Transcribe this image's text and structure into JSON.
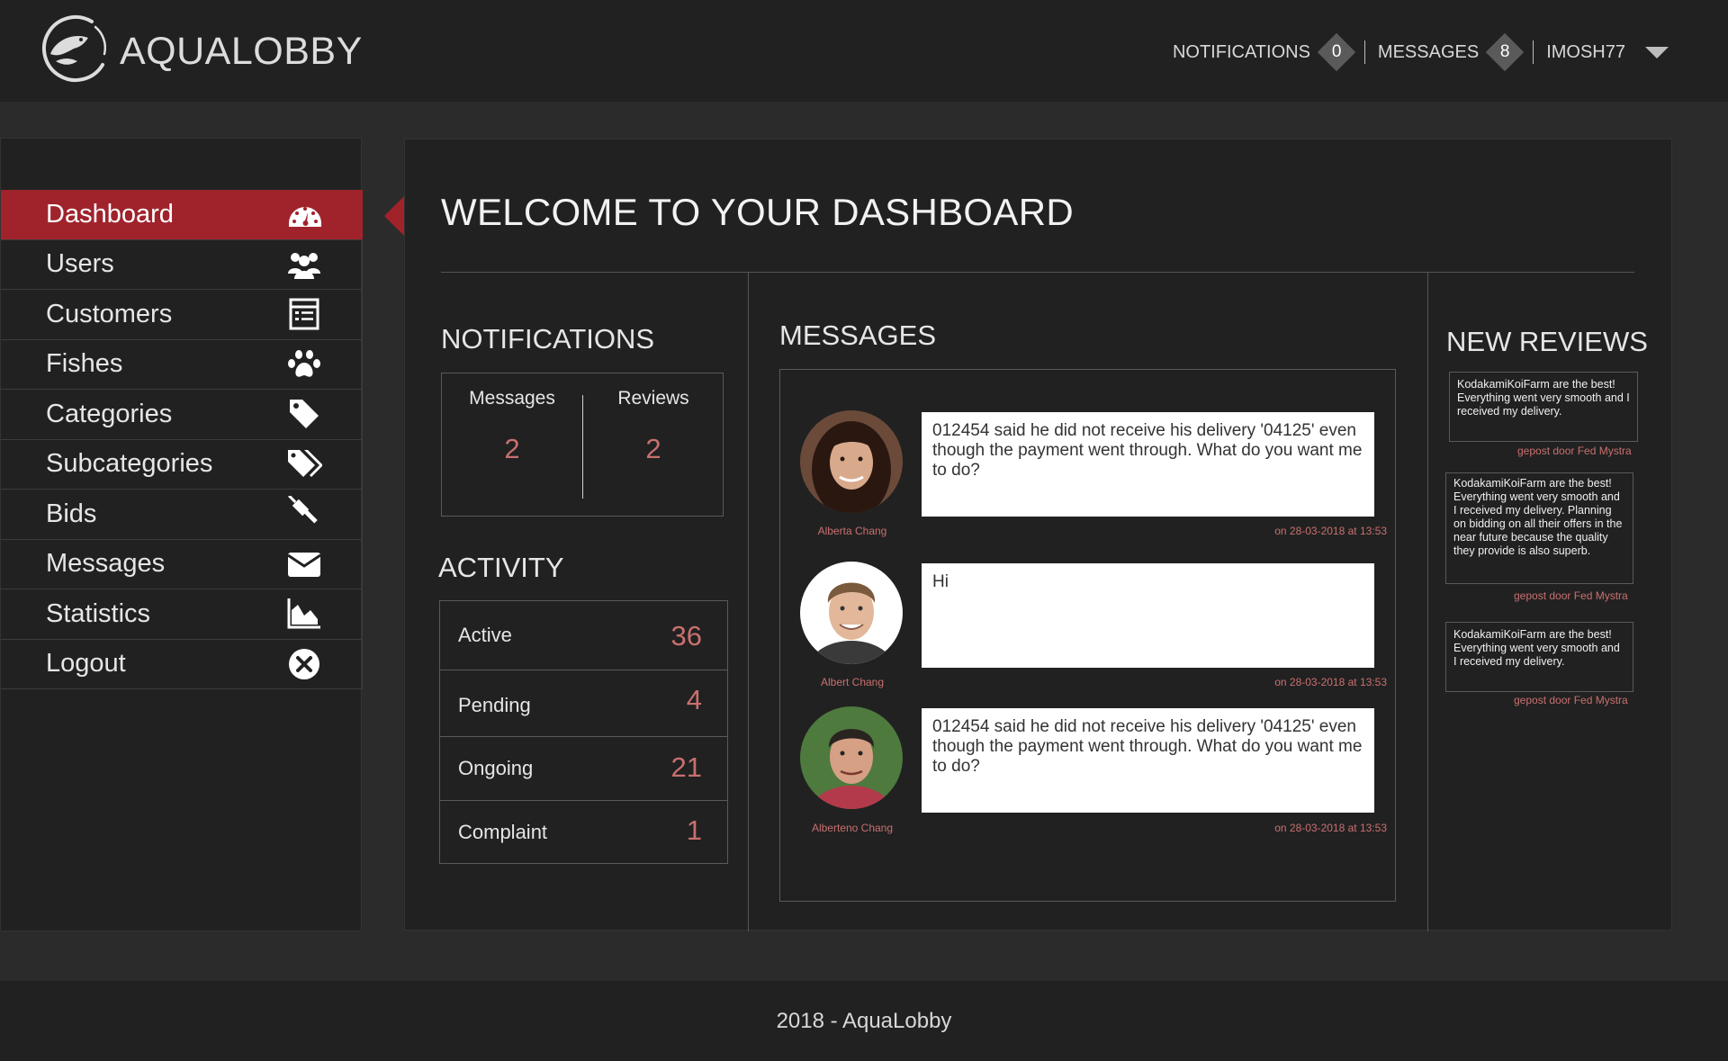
{
  "header": {
    "brand": "AQUALOBBY",
    "notifications_label": "NOTIFICATIONS",
    "notifications_count": "0",
    "messages_label": "MESSAGES",
    "messages_count": "8",
    "user_label": "IMOSH77"
  },
  "sidebar": {
    "items": [
      {
        "label": "Dashboard",
        "icon": "dashboard-icon"
      },
      {
        "label": "Users",
        "icon": "users-icon"
      },
      {
        "label": "Customers",
        "icon": "customers-icon"
      },
      {
        "label": "Fishes",
        "icon": "paw-icon"
      },
      {
        "label": "Categories",
        "icon": "tag-icon"
      },
      {
        "label": "Subcategories",
        "icon": "tags-icon"
      },
      {
        "label": "Bids",
        "icon": "gavel-icon"
      },
      {
        "label": "Messages",
        "icon": "envelope-icon"
      },
      {
        "label": "Statistics",
        "icon": "area-chart-icon"
      },
      {
        "label": "Logout",
        "icon": "close-circle-icon"
      }
    ],
    "active_color": "#a0232c"
  },
  "main": {
    "title": "WELCOME TO YOUR DASHBOARD",
    "notifications": {
      "heading": "NOTIFICATIONS",
      "messages_label": "Messages",
      "messages_value": "2",
      "reviews_label": "Reviews",
      "reviews_value": "2"
    },
    "activity": {
      "heading": "ACTIVITY",
      "rows": [
        {
          "label": "Active",
          "value": "36"
        },
        {
          "label": "Pending",
          "value": "4"
        },
        {
          "label": "Ongoing",
          "value": "21"
        },
        {
          "label": "Complaint",
          "value": "1"
        }
      ]
    },
    "messages": {
      "heading": "MESSAGES",
      "items": [
        {
          "name": "Alberta Chang",
          "text": "012454 said he did not receive his delivery '04125' even though the payment went through. What do you want me to do?",
          "date": "on 28-03-2018 at 13:53"
        },
        {
          "name": "Albert Chang",
          "text": "Hi",
          "date": "on 28-03-2018 at 13:53"
        },
        {
          "name": "Alberteno Chang",
          "text": "012454 said he did not receive his delivery '04125' even though the payment went through. What do you want me to do?",
          "date": "on 28-03-2018 at 13:53"
        }
      ]
    },
    "reviews": {
      "heading": "NEW REVIEWS",
      "items": [
        {
          "text": "KodakamiKoiFarm are the best! Everything went very smooth and I received my delivery.",
          "meta": "gepost door Fed Mystra"
        },
        {
          "text": "KodakamiKoiFarm are the best! Everything went very smooth and I received my delivery. Planning on bidding on all their offers in the near future because the quality they provide is also superb.",
          "meta": "gepost door Fed Mystra"
        },
        {
          "text": "KodakamiKoiFarm are the best! Everything went very smooth and I received my delivery.",
          "meta": "gepost door Fed Mystra"
        }
      ]
    },
    "accent_color": "#c9706f"
  },
  "footer": {
    "text": "2018 - AquaLobby"
  }
}
